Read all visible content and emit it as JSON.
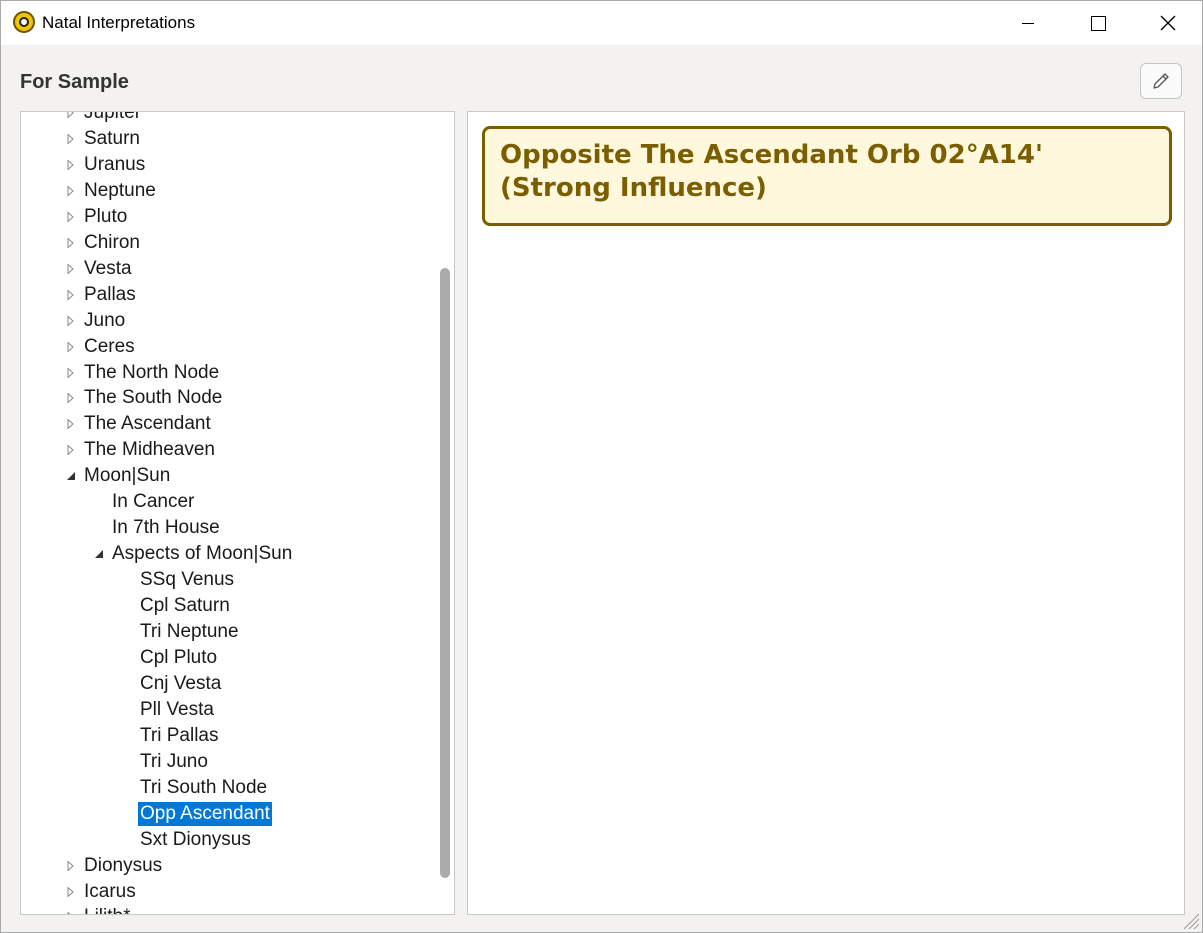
{
  "window": {
    "title": "Natal Interpretations"
  },
  "header": {
    "label": "For Sample",
    "edit_icon": "pencil-icon"
  },
  "tree": {
    "items": [
      {
        "label": "Jupiter",
        "level": 0,
        "state": "collapsed"
      },
      {
        "label": "Saturn",
        "level": 0,
        "state": "collapsed"
      },
      {
        "label": "Uranus",
        "level": 0,
        "state": "collapsed"
      },
      {
        "label": "Neptune",
        "level": 0,
        "state": "collapsed"
      },
      {
        "label": "Pluto",
        "level": 0,
        "state": "collapsed"
      },
      {
        "label": "Chiron",
        "level": 0,
        "state": "collapsed"
      },
      {
        "label": "Vesta",
        "level": 0,
        "state": "collapsed"
      },
      {
        "label": "Pallas",
        "level": 0,
        "state": "collapsed"
      },
      {
        "label": "Juno",
        "level": 0,
        "state": "collapsed"
      },
      {
        "label": "Ceres",
        "level": 0,
        "state": "collapsed"
      },
      {
        "label": "The North Node",
        "level": 0,
        "state": "collapsed"
      },
      {
        "label": "The South Node",
        "level": 0,
        "state": "collapsed"
      },
      {
        "label": "The Ascendant",
        "level": 0,
        "state": "collapsed"
      },
      {
        "label": "The Midheaven",
        "level": 0,
        "state": "collapsed"
      },
      {
        "label": "Moon|Sun",
        "level": 0,
        "state": "expanded"
      },
      {
        "label": "In Cancer",
        "level": 1,
        "state": "leaf"
      },
      {
        "label": "In 7th House",
        "level": 1,
        "state": "leaf"
      },
      {
        "label": "Aspects of Moon|Sun",
        "level": 1,
        "state": "expanded"
      },
      {
        "label": "SSq Venus",
        "level": 2,
        "state": "leaf"
      },
      {
        "label": "Cpl Saturn",
        "level": 2,
        "state": "leaf"
      },
      {
        "label": "Tri Neptune",
        "level": 2,
        "state": "leaf"
      },
      {
        "label": "Cpl Pluto",
        "level": 2,
        "state": "leaf"
      },
      {
        "label": "Cnj Vesta",
        "level": 2,
        "state": "leaf"
      },
      {
        "label": "Pll Vesta",
        "level": 2,
        "state": "leaf"
      },
      {
        "label": "Tri Pallas",
        "level": 2,
        "state": "leaf"
      },
      {
        "label": "Tri Juno",
        "level": 2,
        "state": "leaf"
      },
      {
        "label": "Tri South Node",
        "level": 2,
        "state": "leaf"
      },
      {
        "label": "Opp Ascendant",
        "level": 2,
        "state": "leaf",
        "selected": true
      },
      {
        "label": "Sxt Dionysus",
        "level": 2,
        "state": "leaf"
      },
      {
        "label": "Dionysus",
        "level": 0,
        "state": "collapsed"
      },
      {
        "label": "Icarus",
        "level": 0,
        "state": "collapsed"
      },
      {
        "label": "Lilith*",
        "level": 0,
        "state": "collapsed"
      }
    ],
    "scroll_fraction": 0.21
  },
  "detail": {
    "heading_line1": "Opposite The Ascendant Orb 02°A14'",
    "heading_line2": "(Strong Influence)"
  },
  "colors": {
    "accent": "#0078d7",
    "callout_border": "#7a5e00",
    "callout_bg": "#fff8dc"
  }
}
